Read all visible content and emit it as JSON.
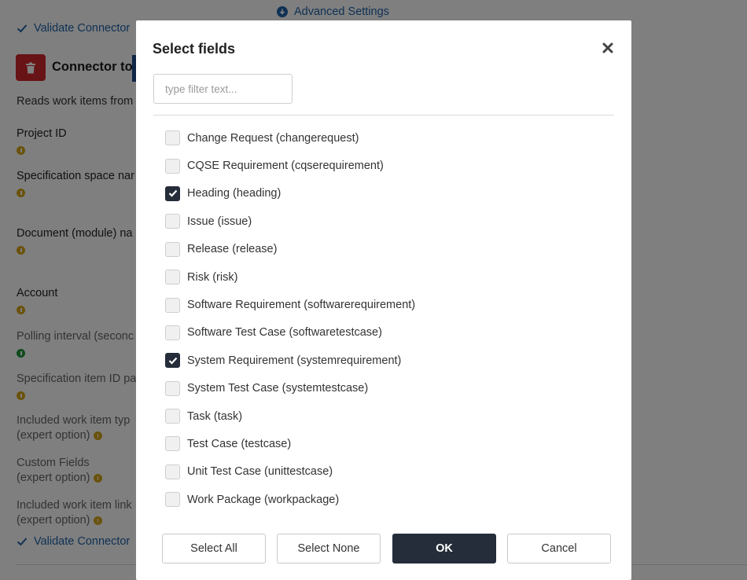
{
  "background": {
    "validate_link_top": "Validate Connector",
    "advanced_settings": "Advanced Settings",
    "connector_title": "Connector to",
    "description": "Reads work items from",
    "fields": [
      {
        "label": "Project ID",
        "note": ""
      },
      {
        "label": "Specification space nar",
        "note": ""
      },
      {
        "label": "Document (module) na",
        "note": ""
      },
      {
        "label": "Account",
        "note": ""
      },
      {
        "label": "Polling interval (seconc",
        "note": ""
      },
      {
        "label": "Specification item ID pa",
        "note": ""
      },
      {
        "label": "Included work item typ",
        "note": "(expert option)"
      },
      {
        "label": "Custom Fields",
        "note": "(expert option)"
      },
      {
        "label": "Included work item link",
        "note": "(expert option)"
      }
    ],
    "validate_link_bottom": "Validate Connector"
  },
  "modal": {
    "title": "Select fields",
    "filter_placeholder": "type filter text...",
    "filter_value": "",
    "items": [
      {
        "label": "Change Request (changerequest)",
        "checked": false
      },
      {
        "label": "CQSE Requirement (cqserequirement)",
        "checked": false
      },
      {
        "label": "Heading (heading)",
        "checked": true
      },
      {
        "label": "Issue (issue)",
        "checked": false
      },
      {
        "label": "Release (release)",
        "checked": false
      },
      {
        "label": "Risk (risk)",
        "checked": false
      },
      {
        "label": "Software Requirement (softwarerequirement)",
        "checked": false
      },
      {
        "label": "Software Test Case (softwaretestcase)",
        "checked": false
      },
      {
        "label": "System Requirement (systemrequirement)",
        "checked": true
      },
      {
        "label": "System Test Case (systemtestcase)",
        "checked": false
      },
      {
        "label": "Task (task)",
        "checked": false
      },
      {
        "label": "Test Case (testcase)",
        "checked": false
      },
      {
        "label": "Unit Test Case (unittestcase)",
        "checked": false
      },
      {
        "label": "Work Package (workpackage)",
        "checked": false
      }
    ],
    "buttons": {
      "select_all": "Select All",
      "select_none": "Select None",
      "ok": "OK",
      "cancel": "Cancel"
    }
  },
  "colors": {
    "accent": "#252c3a",
    "link": "#1f63a8",
    "danger": "#d0262d",
    "info_yellow": "#d4a514",
    "info_green": "#22963f"
  }
}
